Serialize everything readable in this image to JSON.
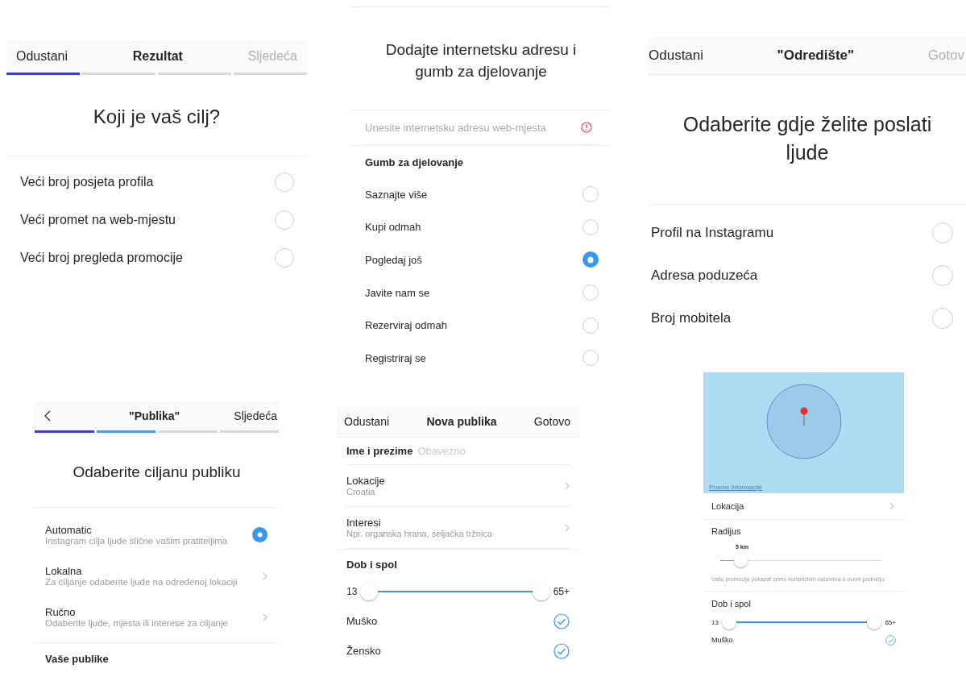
{
  "goal_screen": {
    "header": {
      "cancel": "Odustani",
      "title": "Rezultat",
      "next": "Sljedeća",
      "next_disabled": true
    },
    "steps": [
      {
        "done": true
      },
      {
        "done": false
      },
      {
        "done": false
      },
      {
        "done": false
      }
    ],
    "heading": "Koji je vaš cilj?",
    "options": [
      {
        "label": "Veći broj posjeta profila",
        "selected": false
      },
      {
        "label": "Veći promet na web-mjestu",
        "selected": false
      },
      {
        "label": "Veći broj pregleda promocije",
        "selected": false
      }
    ]
  },
  "website_screen": {
    "heading": "Dodajte internetsku adresu i gumb za djelovanje",
    "url_field": {
      "placeholder": "Unesite internetsku adresu web-mjesta",
      "error": true
    },
    "section_title": "Gumb za djelovanje",
    "options": [
      {
        "label": "Saznajte više",
        "selected": false
      },
      {
        "label": "Kupi odmah",
        "selected": false
      },
      {
        "label": "Pogledaj još",
        "selected": true
      },
      {
        "label": "Javite nam se",
        "selected": false
      },
      {
        "label": "Rezerviraj odmah",
        "selected": false
      },
      {
        "label": "Registriraj se",
        "selected": false
      }
    ]
  },
  "destination_screen": {
    "header": {
      "cancel": "Odustani",
      "title": "\"Odredište\"",
      "done": "Gotov",
      "done_disabled": true
    },
    "heading": "Odaberite gdje želite poslati ljude",
    "options": [
      {
        "label": "Profil na Instagramu",
        "selected": false
      },
      {
        "label": "Adresa poduzeća",
        "selected": false
      },
      {
        "label": "Broj mobitela",
        "selected": false
      }
    ]
  },
  "audience_screen": {
    "header": {
      "title": "\"Publika\"",
      "next": "Sljedeća"
    },
    "steps": [
      {
        "done": true
      },
      {
        "done": true
      },
      {
        "done": false
      },
      {
        "done": false
      }
    ],
    "heading": "Odaberite ciljanu publiku",
    "options": [
      {
        "kind": "radio",
        "title": "Automatic",
        "subtitle": "Instagram cilja ljude slične vašim pratiteljima",
        "selected": true
      },
      {
        "kind": "link",
        "title": "Lokalna",
        "subtitle": "Za ciljanje odaberite ljude na određenoj lokaciji"
      },
      {
        "kind": "link",
        "title": "Ručno",
        "subtitle": "Odaberite ljude, mjesta ili interese za ciljanje"
      }
    ],
    "section_title": "Vaše publike"
  },
  "new_audience_screen": {
    "header": {
      "cancel": "Odustani",
      "title": "Nova publika",
      "done": "Gotovo"
    },
    "name_field": {
      "label": "Ime i prezime",
      "placeholder": "Obavezno"
    },
    "rows": [
      {
        "title": "Lokacije",
        "subtitle": "Croatia"
      },
      {
        "title": "Interesi",
        "subtitle": "Npr. organska hrana, seljačka tržnica"
      }
    ],
    "age_gender": {
      "title": "Dob i spol",
      "min_label": "13",
      "max_label": "65+",
      "level": 1,
      "genders": [
        {
          "label": "Muško",
          "checked": true
        },
        {
          "label": "Žensko",
          "checked": true
        }
      ]
    }
  },
  "location_screen": {
    "map": {
      "legal_link": "Pravne informacije"
    },
    "location_row": "Lokacija",
    "radius": {
      "title": "Radijus",
      "reading": "5 km",
      "level": 0.13,
      "note": "Vašu promociju pokazat ćemo korisničkim računima u ovom području."
    },
    "age_gender": {
      "title": "Dob i spol",
      "min_label": "13",
      "max_label": "65+",
      "level": 1,
      "genders": [
        {
          "label": "Muško",
          "checked": true
        }
      ]
    }
  }
}
